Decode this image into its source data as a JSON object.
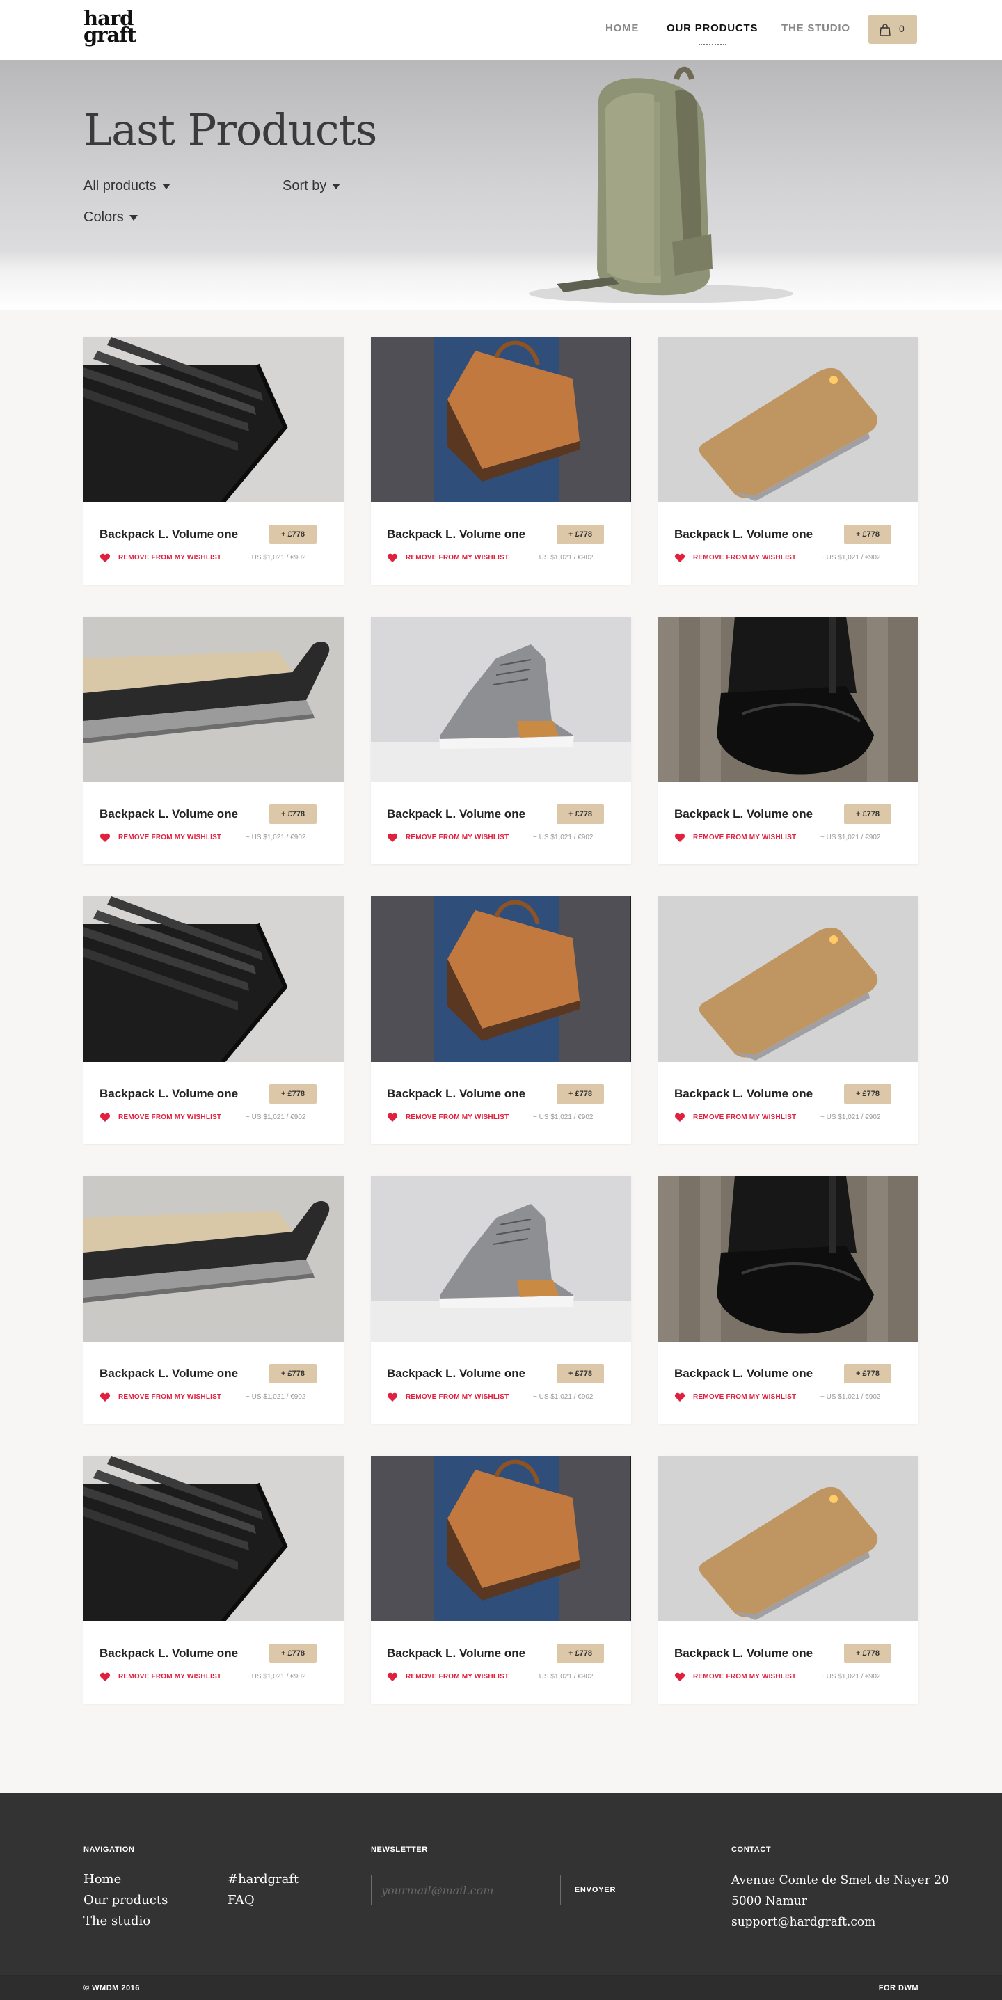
{
  "brand": {
    "logo_line1": "hard",
    "logo_line2": "graft"
  },
  "nav": {
    "items": [
      {
        "label": "HOME"
      },
      {
        "label": "OUR PRODUCTS"
      },
      {
        "label": "THE STUDIO"
      }
    ],
    "active": "OUR PRODUCTS"
  },
  "cart": {
    "count": "0",
    "icon": "shopping-bag-icon"
  },
  "hero": {
    "title": "Last Products",
    "filters": {
      "all_products": "All products",
      "sort_by": "Sort by",
      "colors": "Colors"
    }
  },
  "products": [
    {
      "title": "Backpack L. Volume one",
      "price": "+ £778",
      "wishlist": "REMOVE FROM MY WISHLIST",
      "conversion": "~ US $1,021 / €902",
      "image": "wallet"
    },
    {
      "title": "Backpack L. Volume one",
      "price": "+ £778",
      "wishlist": "REMOVE FROM MY WISHLIST",
      "conversion": "~ US $1,021 / €902",
      "image": "leather-bag"
    },
    {
      "title": "Backpack L. Volume one",
      "price": "+ £778",
      "wishlist": "REMOVE FROM MY WISHLIST",
      "conversion": "~ US $1,021 / €902",
      "image": "phone-case"
    },
    {
      "title": "Backpack L. Volume one",
      "price": "+ £778",
      "wishlist": "REMOVE FROM MY WISHLIST",
      "conversion": "~ US $1,021 / €902",
      "image": "laptop-sleeve"
    },
    {
      "title": "Backpack L. Volume one",
      "price": "+ £778",
      "wishlist": "REMOVE FROM MY WISHLIST",
      "conversion": "~ US $1,021 / €902",
      "image": "sneaker"
    },
    {
      "title": "Backpack L. Volume one",
      "price": "+ £778",
      "wishlist": "REMOVE FROM MY WISHLIST",
      "conversion": "~ US $1,021 / €902",
      "image": "black-bag"
    },
    {
      "title": "Backpack L. Volume one",
      "price": "+ £778",
      "wishlist": "REMOVE FROM MY WISHLIST",
      "conversion": "~ US $1,021 / €902",
      "image": "wallet"
    },
    {
      "title": "Backpack L. Volume one",
      "price": "+ £778",
      "wishlist": "REMOVE FROM MY WISHLIST",
      "conversion": "~ US $1,021 / €902",
      "image": "leather-bag"
    },
    {
      "title": "Backpack L. Volume one",
      "price": "+ £778",
      "wishlist": "REMOVE FROM MY WISHLIST",
      "conversion": "~ US $1,021 / €902",
      "image": "phone-case"
    },
    {
      "title": "Backpack L. Volume one",
      "price": "+ £778",
      "wishlist": "REMOVE FROM MY WISHLIST",
      "conversion": "~ US $1,021 / €902",
      "image": "laptop-sleeve"
    },
    {
      "title": "Backpack L. Volume one",
      "price": "+ £778",
      "wishlist": "REMOVE FROM MY WISHLIST",
      "conversion": "~ US $1,021 / €902",
      "image": "sneaker"
    },
    {
      "title": "Backpack L. Volume one",
      "price": "+ £778",
      "wishlist": "REMOVE FROM MY WISHLIST",
      "conversion": "~ US $1,021 / €902",
      "image": "black-bag"
    },
    {
      "title": "Backpack L. Volume one",
      "price": "+ £778",
      "wishlist": "REMOVE FROM MY WISHLIST",
      "conversion": "~ US $1,021 / €902",
      "image": "wallet"
    },
    {
      "title": "Backpack L. Volume one",
      "price": "+ £778",
      "wishlist": "REMOVE FROM MY WISHLIST",
      "conversion": "~ US $1,021 / €902",
      "image": "leather-bag"
    },
    {
      "title": "Backpack L. Volume one",
      "price": "+ £778",
      "wishlist": "REMOVE FROM MY WISHLIST",
      "conversion": "~ US $1,021 / €902",
      "image": "phone-case"
    }
  ],
  "footer": {
    "navigation": {
      "heading": "NAVIGATION",
      "links": [
        "Home",
        "Our products",
        "The studio"
      ],
      "links2": [
        "#hardgraft",
        "FAQ"
      ]
    },
    "newsletter": {
      "heading": "NEWSLETTER",
      "placeholder": "yourmail@mail.com",
      "value": "",
      "button": "ENVOYER"
    },
    "contact": {
      "heading": "CONTACT",
      "lines": [
        "Avenue Comte de Smet de Nayer 20",
        "5000 Namur",
        "support@hardgraft.com"
      ]
    },
    "copyright": "© WMDM 2016",
    "credit": "FOR DWM"
  },
  "colors": {
    "accent_tan": "#dcc8a8",
    "wishlist_red": "#e0213e",
    "footer_bg": "#343333",
    "page_bg": "#f7f6f4"
  }
}
